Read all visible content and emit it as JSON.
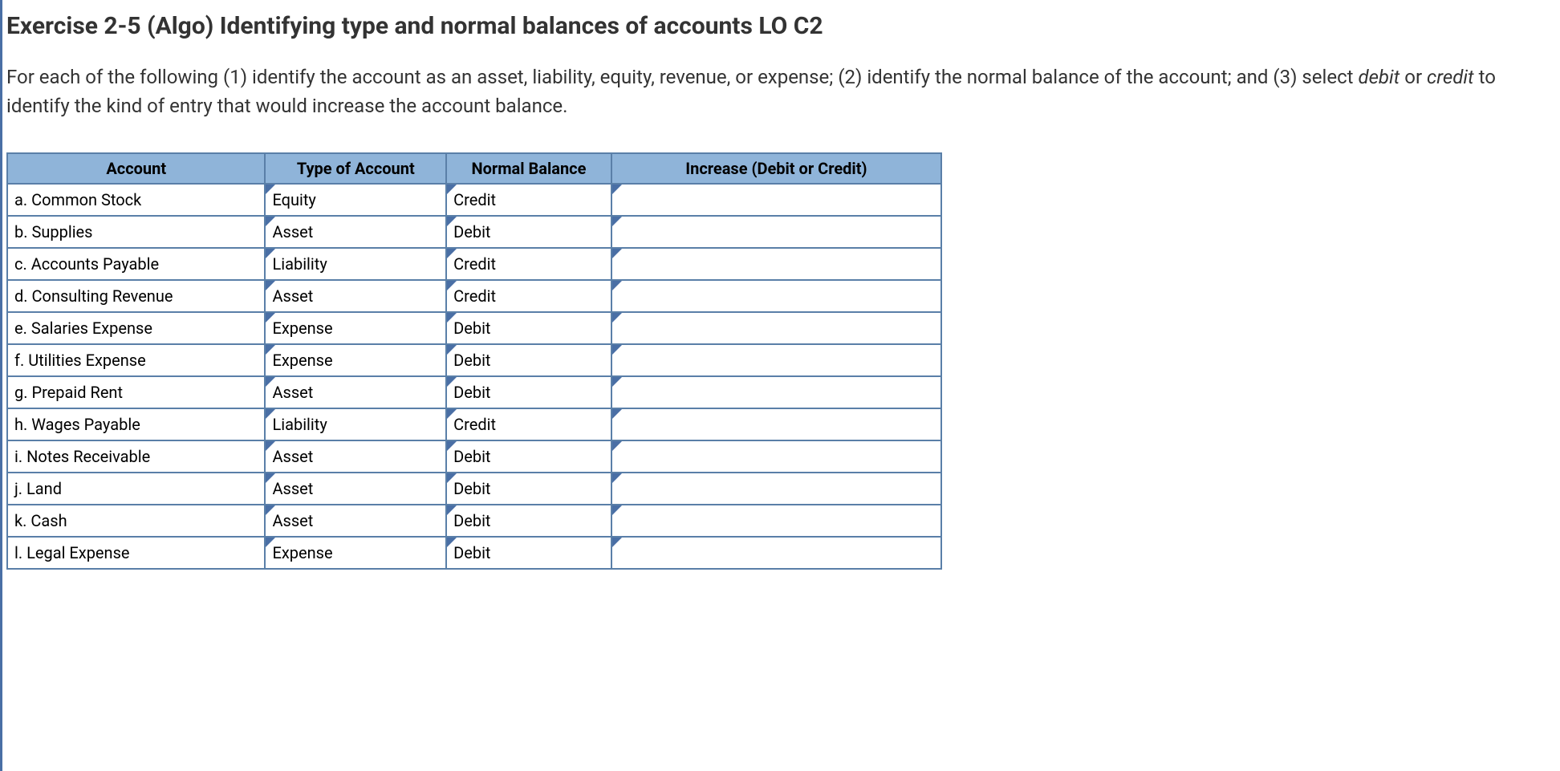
{
  "heading": "Exercise 2-5 (Algo) Identifying type and normal balances of accounts LO C2",
  "instructions_parts": {
    "p1": "For each of the following (1) identify the account as an asset, liability, equity, revenue, or expense; (2) identify the normal balance of the account; and (3) select ",
    "p2": "debit",
    "p3": " or ",
    "p4": "credit",
    "p5": " to identify the kind of entry that would increase the account balance."
  },
  "headers": {
    "account": "Account",
    "type": "Type of Account",
    "balance": "Normal Balance",
    "increase": "Increase (Debit or Credit)"
  },
  "rows": [
    {
      "account": "a. Common Stock",
      "type": "Equity",
      "balance": "Credit",
      "increase": ""
    },
    {
      "account": "b. Supplies",
      "type": "Asset",
      "balance": "Debit",
      "increase": ""
    },
    {
      "account": "c. Accounts Payable",
      "type": "Liability",
      "balance": "Credit",
      "increase": ""
    },
    {
      "account": "d. Consulting Revenue",
      "type": "Asset",
      "balance": "Credit",
      "increase": ""
    },
    {
      "account": "e. Salaries Expense",
      "type": "Expense",
      "balance": "Debit",
      "increase": ""
    },
    {
      "account": "f. Utilities Expense",
      "type": "Expense",
      "balance": "Debit",
      "increase": ""
    },
    {
      "account": "g. Prepaid Rent",
      "type": "Asset",
      "balance": "Debit",
      "increase": ""
    },
    {
      "account": "h. Wages Payable",
      "type": "Liability",
      "balance": "Credit",
      "increase": ""
    },
    {
      "account": "i. Notes Receivable",
      "type": "Asset",
      "balance": "Debit",
      "increase": ""
    },
    {
      "account": "j. Land",
      "type": "Asset",
      "balance": "Debit",
      "increase": ""
    },
    {
      "account": "k. Cash",
      "type": "Asset",
      "balance": "Debit",
      "increase": ""
    },
    {
      "account": "l. Legal Expense",
      "type": "Expense",
      "balance": "Debit",
      "increase": ""
    }
  ]
}
